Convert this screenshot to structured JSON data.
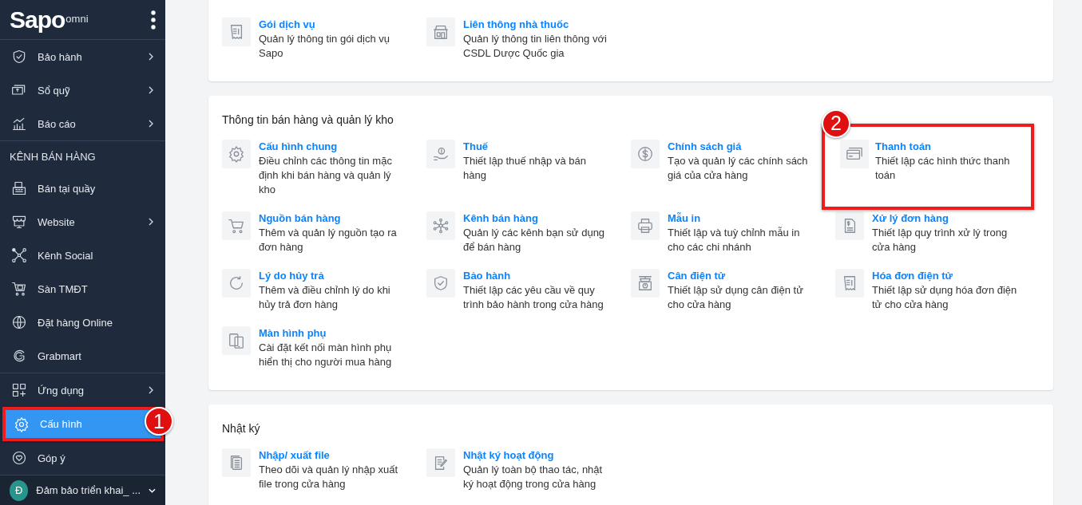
{
  "sidebar": {
    "logo": {
      "brand": "Sapo",
      "suffix": "omni"
    },
    "groups": [
      {
        "items": [
          {
            "label": "Bảo hành",
            "has_submenu": true,
            "selected": false
          },
          {
            "label": "Sổ quỹ",
            "has_submenu": true,
            "selected": false
          },
          {
            "label": "Báo cáo",
            "has_submenu": true,
            "selected": false
          }
        ]
      },
      {
        "header": "KÊNH BÁN HÀNG",
        "items": [
          {
            "label": "Bán tại quầy",
            "has_submenu": false,
            "selected": false
          },
          {
            "label": "Website",
            "has_submenu": true,
            "selected": false
          },
          {
            "label": "Kênh Social",
            "has_submenu": false,
            "selected": false
          },
          {
            "label": "Sàn TMĐT",
            "has_submenu": false,
            "selected": false
          },
          {
            "label": "Đặt hàng Online",
            "has_submenu": false,
            "selected": false
          },
          {
            "label": "Grabmart",
            "has_submenu": false,
            "selected": false
          }
        ]
      },
      {
        "items": [
          {
            "label": "Ứng dụng",
            "has_submenu": true,
            "selected": false
          },
          {
            "label": "Cấu hình",
            "has_submenu": false,
            "selected": true,
            "callout": "1"
          },
          {
            "label": "Góp ý",
            "has_submenu": false,
            "selected": false
          }
        ]
      }
    ],
    "account": {
      "initial": "Đ",
      "name": "Đảm bảo triển khai_ ..."
    }
  },
  "sections": [
    {
      "items": [
        {
          "title": "Gói dịch vụ",
          "description": "Quản lý thông tin gói dịch vụ Sapo"
        },
        {
          "title": "Liên thông nhà thuốc",
          "description": "Quản lý thông tin liên thông với CSDL Dược Quốc gia"
        }
      ]
    },
    {
      "title": "Thông tin bán hàng và quản lý kho",
      "items": [
        {
          "title": "Cấu hình chung",
          "description": "Điều chỉnh các thông tin mặc định khi bán hàng và quản lý kho"
        },
        {
          "title": "Thuế",
          "description": "Thiết lập thuế nhập và bán hàng"
        },
        {
          "title": "Chính sách giá",
          "description": "Tạo và quản lý các chính sách giá của cửa hàng"
        },
        {
          "title": "Thanh toán",
          "description": "Thiết lập các hình thức thanh toán",
          "callout": "2"
        },
        {
          "title": "Nguồn bán hàng",
          "description": "Thêm và quản lý nguồn tạo ra đơn hàng"
        },
        {
          "title": "Kênh bán hàng",
          "description": "Quản lý các kênh bạn sử dụng để bán hàng"
        },
        {
          "title": "Mẫu in",
          "description": "Thiết lập và tuỳ chỉnh mẫu in cho các chi nhánh"
        },
        {
          "title": "Xử lý đơn hàng",
          "description": "Thiết lập quy trình xử lý trong cửa hàng"
        },
        {
          "title": "Lý do hủy trả",
          "description": "Thêm và điều chỉnh lý do khi hủy trả đơn hàng"
        },
        {
          "title": "Bảo hành",
          "description": "Thiết lập các yêu cầu về quy trình bảo hành trong cửa hàng"
        },
        {
          "title": "Cân điện tử",
          "description": "Thiết lập sử dụng cân điện tử cho cửa hàng"
        },
        {
          "title": "Hóa đơn điện tử",
          "description": "Thiết lập sử dụng hóa đơn điện tử cho cửa hàng"
        },
        {
          "title": "Màn hình phụ",
          "description": "Cài đặt kết nối màn hình phụ hiển thị cho người mua hàng"
        }
      ]
    },
    {
      "title": "Nhật ký",
      "items": [
        {
          "title": "Nhập/ xuất file",
          "description": "Theo dõi và quản lý nhập xuất file trong cửa hàng"
        },
        {
          "title": "Nhật ký hoạt động",
          "description": "Quản lý toàn bộ thao tác, nhật ký hoạt động trong cửa hàng"
        }
      ]
    }
  ]
}
